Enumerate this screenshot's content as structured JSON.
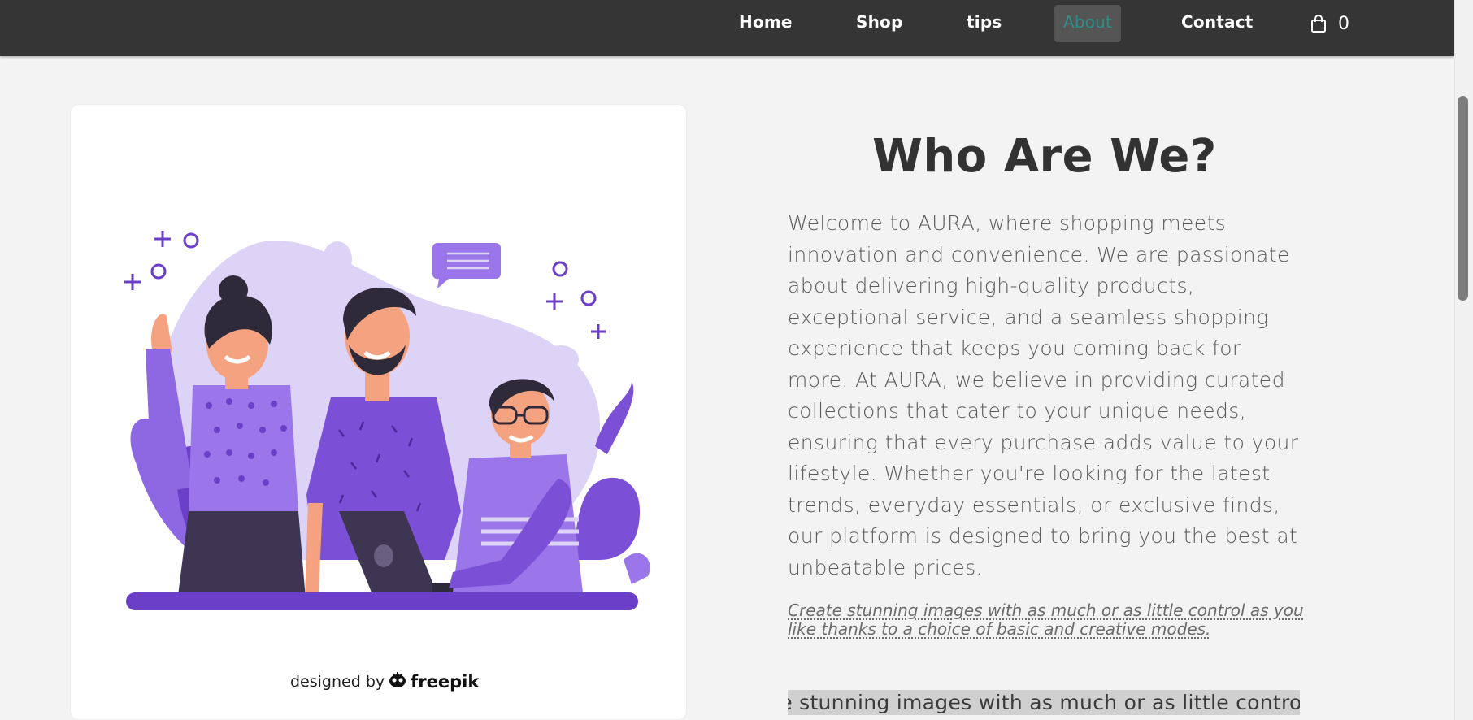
{
  "nav": {
    "items": [
      {
        "label": "Home"
      },
      {
        "label": "Shop"
      },
      {
        "label": "tips"
      },
      {
        "label": "About"
      },
      {
        "label": "Contact"
      }
    ],
    "active": "About",
    "cart_count": "0"
  },
  "about": {
    "title": "Who Are We?",
    "body": "Welcome to AURA, where shopping meets innovation and convenience. We are passionate about delivering high-quality products, exceptional service, and a seamless shopping experience that keeps you coming back for more. At AURA, we believe in providing curated collections that cater to your unique needs, ensuring that every purchase adds value to your lifestyle. Whether you're looking for the latest trends, everyday essentials, or exclusive finds, our platform is designed to bring you the best at unbeatable prices.",
    "note": "Create stunning images with as much or as little control as you like thanks to a choice of basic and creative modes.",
    "marquee": "Create stunning images with as much or as little contro"
  },
  "image_card": {
    "credit_prefix": "designed by",
    "credit_brand": "freepik"
  },
  "colors": {
    "navbar": "#353535",
    "active_tab_bg": "#555555",
    "active_tab_text": "#2b8f86",
    "page_bg": "#f3f3f3",
    "illustration_purple": "#7b4fd6",
    "illustration_lavender": "#ddd3f7"
  }
}
